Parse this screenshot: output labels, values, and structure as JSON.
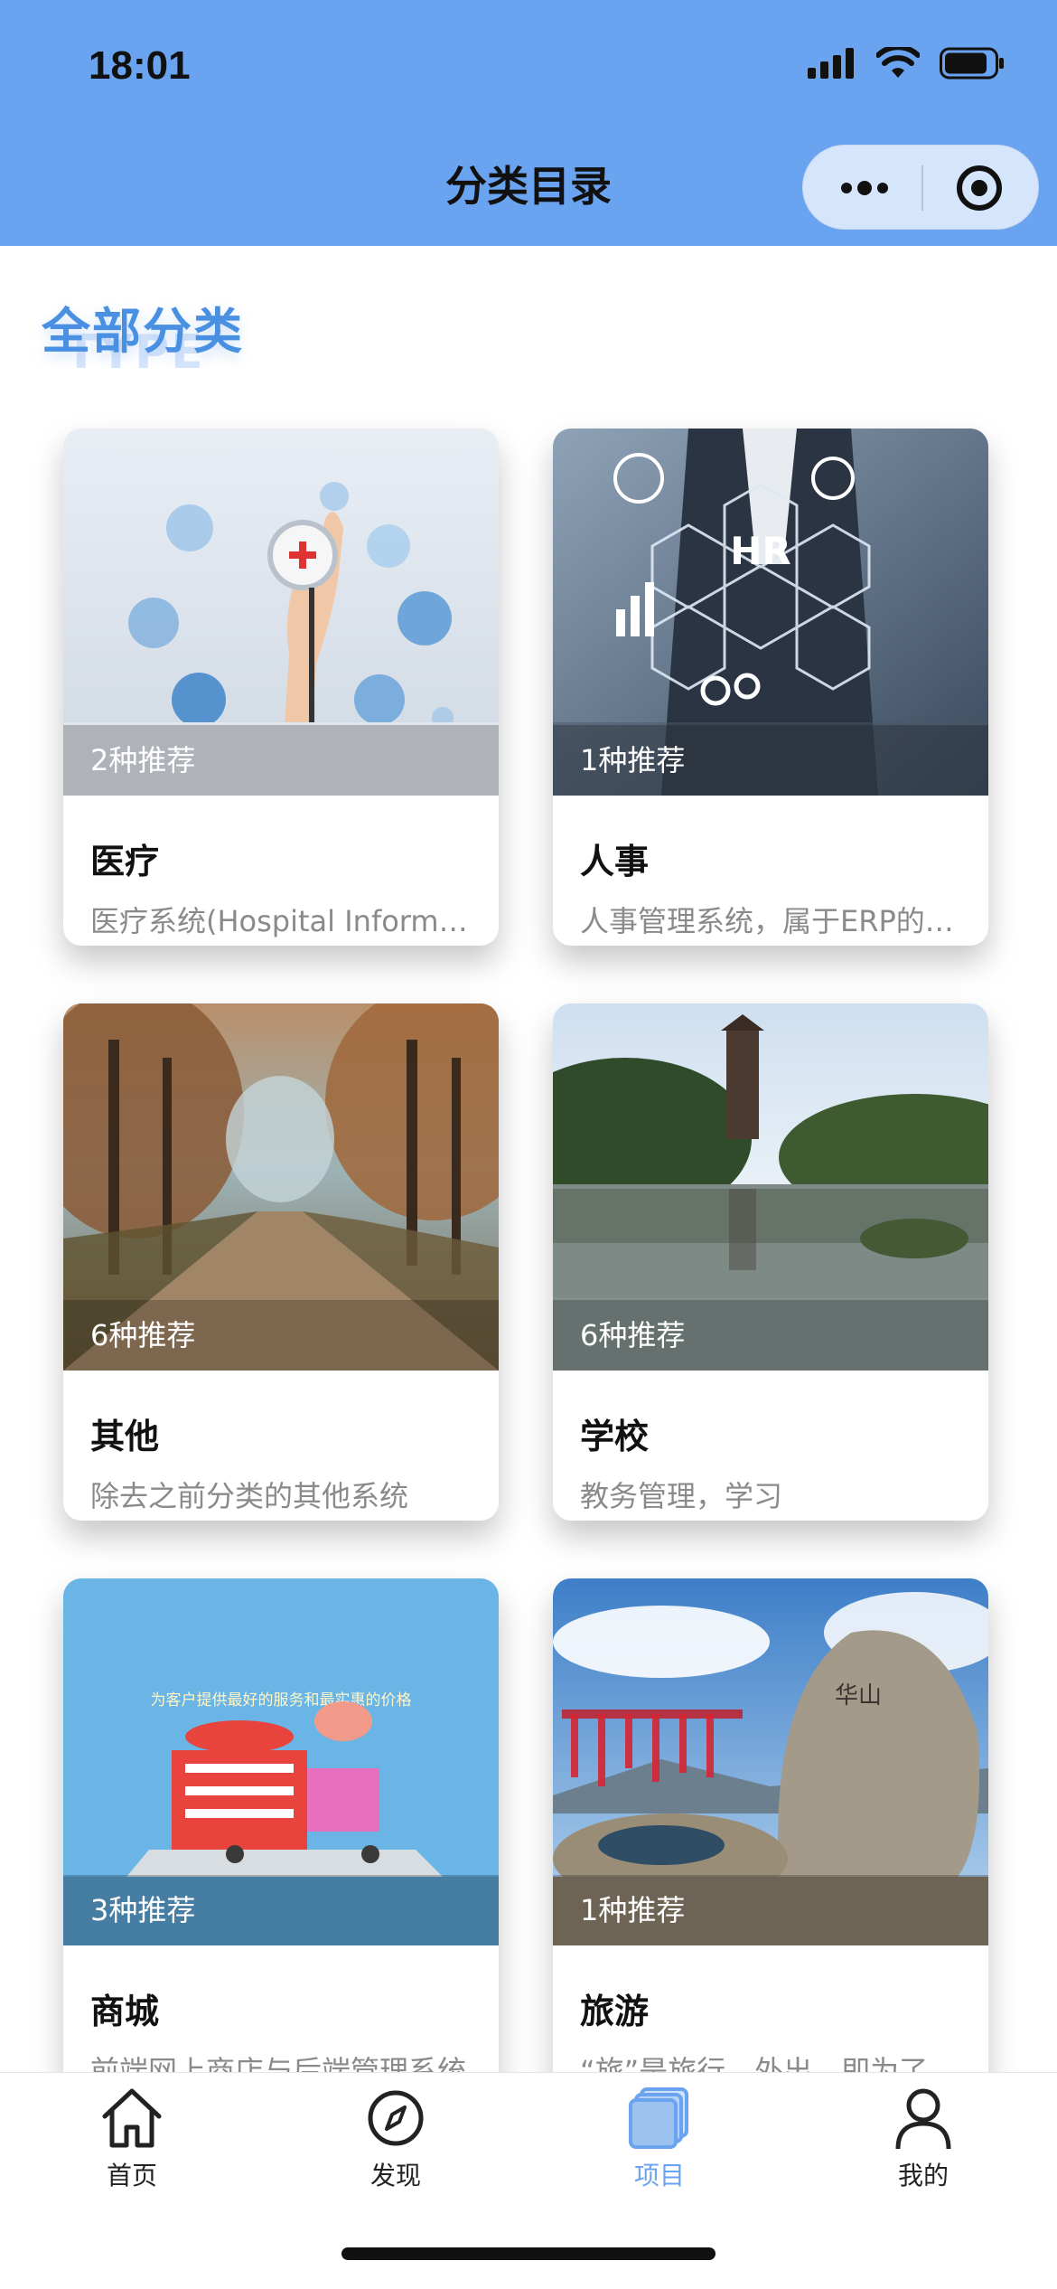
{
  "status_bar": {
    "time": "18:01"
  },
  "nav": {
    "title": "分类目录"
  },
  "capsule": {
    "more_icon": "more-dots-icon",
    "close_icon": "target-icon"
  },
  "section": {
    "title": "全部分类",
    "subtitle": "TYPE"
  },
  "categories": [
    {
      "name": "医疗",
      "count": "2种推荐",
      "desc": "医疗系统(Hospital Information System)",
      "image": "medical"
    },
    {
      "name": "人事",
      "count": "1种推荐",
      "desc": "人事管理系统，属于ERP的一部分",
      "image": "hr"
    },
    {
      "name": "其他",
      "count": "6种推荐",
      "desc": "除去之前分类的其他系统",
      "image": "forest-road"
    },
    {
      "name": "学校",
      "count": "6种推荐",
      "desc": "教务管理，学习",
      "image": "campus-lake"
    },
    {
      "name": "商城",
      "count": "3种推荐",
      "desc": "前端网上商店与后端管理系统",
      "image": "shopping",
      "image_text": "为客户提供最好的服务和最实惠的价格"
    },
    {
      "name": "旅游",
      "count": "1种推荐",
      "desc": "“旅”是旅行、外出，即为了实现某一目的",
      "image": "mountain-stone",
      "image_text": "华山"
    }
  ],
  "tabbar": {
    "items": [
      {
        "label": "首页",
        "icon": "home-icon"
      },
      {
        "label": "发现",
        "icon": "compass-icon"
      },
      {
        "label": "项目",
        "icon": "cards-icon",
        "active": true
      },
      {
        "label": "我的",
        "icon": "user-icon"
      }
    ]
  },
  "colors": {
    "header_bg": "#6aa3ef",
    "accent": "#4a90e2",
    "active_tab": "#6aa3ef"
  }
}
